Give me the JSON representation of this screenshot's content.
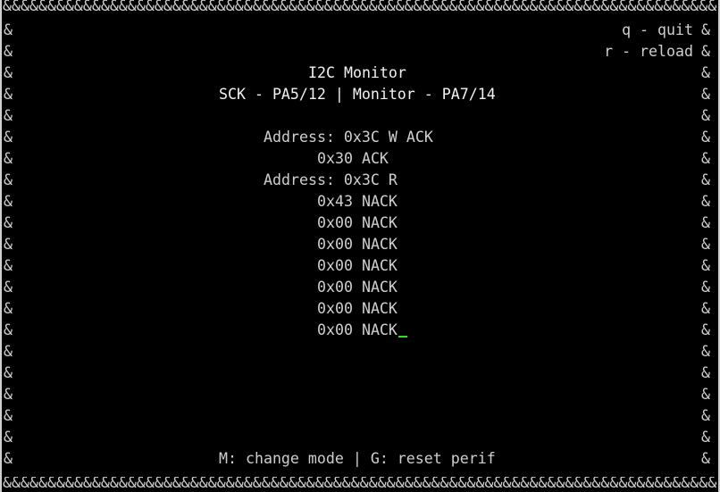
{
  "border": {
    "top": "&&&&&&&&&&&&&&&&&&&&&&&&&&&&&&&&&&&&&&&&&&&&&&&&&&&&&&&&&&&&&&&&&&&&&&&&&&&&&&&&&&&&&&",
    "bottom": "&&&&&&&&&&&&&&&&&&&&&&&&&&&&&&&&&&&&&&&&&&&&&&&&&&&&&&&&&&&&&&&&&&&&&&&&&&&&&&&&&&&&&&",
    "side": "&"
  },
  "hints": {
    "quit": "q - quit",
    "reload": "r - reload"
  },
  "header": {
    "title": "I2C Monitor",
    "pins": "SCK - PA5/12 | Monitor - PA7/14"
  },
  "log": [
    "Address: 0x3C W ACK",
    "0x30 ACK",
    "Address: 0x3C R",
    "0x43 NACK",
    "0x00 NACK",
    "0x00 NACK",
    "0x00 NACK",
    "0x00 NACK",
    "0x00 NACK",
    "0x00 NACK"
  ],
  "footer": "M: change mode | G: reset perif",
  "colors": {
    "background": "#000000",
    "text": "#cfcfcf",
    "cursor": "#3fd13f"
  }
}
